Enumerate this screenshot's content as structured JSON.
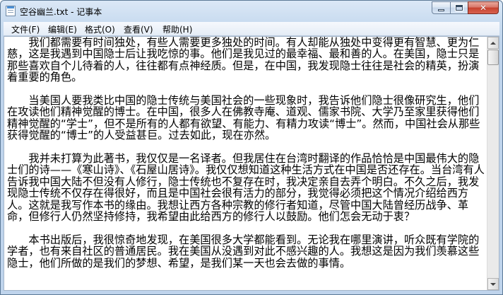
{
  "window": {
    "title": "空谷幽兰.txt - 记事本",
    "icon": "notepad-icon"
  },
  "controls": {
    "minimize_icon": "minimize-icon",
    "maximize_icon": "maximize-icon",
    "close_icon": "close-icon",
    "close_glyph": "✕"
  },
  "menu": {
    "items": [
      {
        "label": "文件(F)"
      },
      {
        "label": "编辑(E)"
      },
      {
        "label": "格式(O)"
      },
      {
        "label": "查看(V)"
      },
      {
        "label": "帮助(H)"
      }
    ]
  },
  "document": {
    "paragraphs": [
      "我们都需要有时间独处，有些人需要更多独处的时间。有人却能从独处中变得更有智慧、更为仁慈，这是我遇到中国隐士后让我吃惊的事。他们是我见过的最幸福、最和善的人。在美国，隐士只是那些喜欢自个儿待着的人，往往都有点神经质。但是，在中国，我发现隐士往往是社会的精英，扮演着重要的角色。",
      "当美国人要我类比中国的隐士传统与美国社会的一些现象时，我告诉他们隐士很像研究生，他们在攻读他们精神觉醒的博士。在中国，很多人在佛教寺庵、道观、儒家书院、大学乃至家里获得他们精神觉醒的“学士”，但不是所有的人都有欲望、有能力、有精力攻读“博士”。然而，中国社会从那些获得觉醒的“博士”的人受益甚巨。过去如此，现在亦然。",
      "我并未打算为此著书，我仅仅是一名译者。但我居住在台湾时翻译的作品恰恰是中国最伟大的隐士们的诗——《寒山诗》、《石屋山居诗》。我仅仅想知道这种生活方式在中国是否还存在。当台湾有人告诉我中国大陆不但没有人修行，隐士传统也不复存在时，我决定亲自去弄个明白。不久之后，我发现隐士传统不仅存在得很好，而且是中国社会很有活力的部分，我觉得必须把这个情况介绍给西方人。这就是我写作本书的缘由。我想让西方各种宗教的修行者知道，尽管中国大陆曾经历战争、革命，但修行人仍然坚持修持，我希望由此给西方的修行人以鼓励。他们怎会无动于衷？",
      "本书出版后，我很惊奇地发现，在美国很多大学都能看到。无论我在哪里演讲，听众既有学院的学者，也有来自社区的普通居民。我在美国从没遇到对此不感兴趣的人。我想这是因为我们羡慕这些隐士，他们所做的是我们的梦想、希望，是我们某一天也会去做的事情。"
    ]
  }
}
